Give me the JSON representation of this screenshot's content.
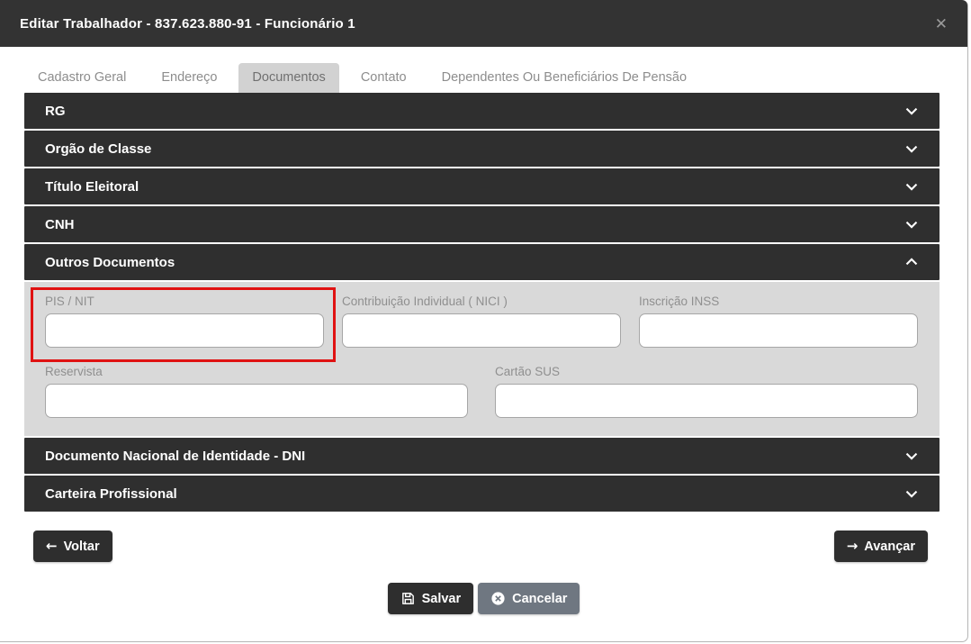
{
  "modal": {
    "title": "Editar Trabalhador - 837.623.880-91 - Funcionário 1",
    "close_glyph": "✕"
  },
  "tabs": [
    {
      "label": "Cadastro Geral",
      "active": false
    },
    {
      "label": "Endereço",
      "active": false
    },
    {
      "label": "Documentos",
      "active": true
    },
    {
      "label": "Contato",
      "active": false
    },
    {
      "label": "Dependentes Ou Beneficiários De Pensão",
      "active": false
    }
  ],
  "accordion": {
    "items": [
      {
        "title": "RG",
        "state": "collapsed"
      },
      {
        "title": "Orgão de Classe",
        "state": "collapsed"
      },
      {
        "title": "Título Eleitoral",
        "state": "collapsed"
      },
      {
        "title": "CNH",
        "state": "collapsed"
      },
      {
        "title": "Outros Documentos",
        "state": "expanded"
      },
      {
        "title": "Documento Nacional de Identidade - DNI",
        "state": "collapsed"
      },
      {
        "title": "Carteira Profissional",
        "state": "collapsed"
      }
    ]
  },
  "outros_documentos_fields": {
    "row1": [
      {
        "label": "PIS / NIT",
        "value": "",
        "highlighted": true
      },
      {
        "label": "Contribuição Individual ( NICI )",
        "value": "",
        "highlighted": false
      },
      {
        "label": "Inscrição INSS",
        "value": "",
        "highlighted": false
      }
    ],
    "row2": [
      {
        "label": "Reservista",
        "value": "",
        "highlighted": false
      },
      {
        "label": "Cartão SUS",
        "value": "",
        "highlighted": false
      }
    ]
  },
  "buttons": {
    "voltar": {
      "label": "Voltar",
      "icon": "arrow-left",
      "arrow_glyph": "←"
    },
    "avancar": {
      "label": "Avançar",
      "icon": "arrow-right",
      "arrow_glyph": "→"
    },
    "salvar": {
      "label": "Salvar",
      "icon": "save-floppy"
    },
    "cancelar": {
      "label": "Cancelar",
      "icon": "circle-x"
    }
  },
  "colors": {
    "header_bg": "#333333",
    "accordion_bg": "#2f2f2f",
    "panel_bg": "#d9d9d9",
    "active_tab_bg": "#d2d2d2",
    "cancel_button_bg": "#6f7781",
    "highlight_red": "#e01212"
  }
}
